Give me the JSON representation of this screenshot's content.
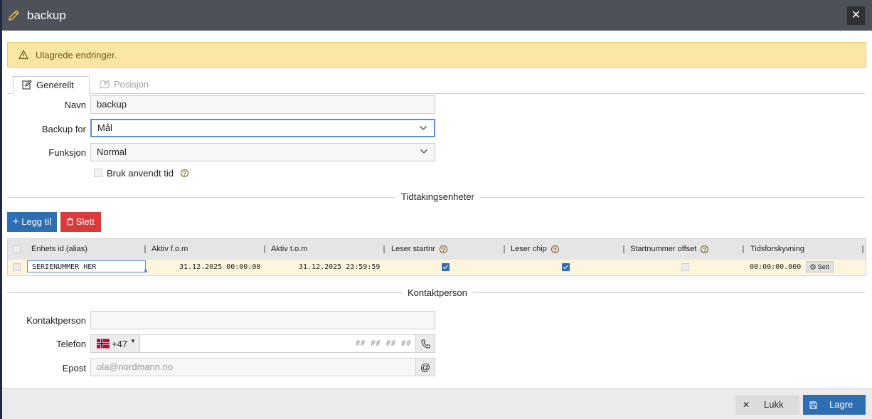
{
  "window": {
    "title": "backup",
    "close_glyph": "✕"
  },
  "warning": {
    "text": "Ulagrede endringer.",
    "icon": "warning-icon"
  },
  "tabs": [
    {
      "label": "Generellt",
      "icon": "edit-icon",
      "active": true
    },
    {
      "label": "Posisjon",
      "icon": "map-icon",
      "active": false
    }
  ],
  "form": {
    "name_label": "Navn",
    "name_value": "backup",
    "backup_for_label": "Backup for",
    "backup_for_value": "Mål",
    "function_label": "Funksjon",
    "function_value": "Normal",
    "use_applied_time_label": "Bruk anvendt tid"
  },
  "timing_section": {
    "title": "Tidtakingsenheter",
    "add_button": "Legg til",
    "delete_button": "Slett",
    "columns": [
      "Enhets id (alias)",
      "Aktiv f.o.m",
      "Aktiv t.o.m",
      "Leser startnr",
      "Leser chip",
      "Startnummer offset",
      "Tidsforskyvning"
    ],
    "rows": [
      {
        "id": "SERIENUMMER HER",
        "active_from": "31.12.2025 00:00:00",
        "active_to": "31.12.2025 23:59:59",
        "reads_startnr": true,
        "reads_chip": true,
        "startnr_offset": false,
        "time_shift": "00:00:00.000",
        "set_label": "Sett"
      }
    ]
  },
  "contact_section": {
    "title": "Kontaktperson",
    "contact_label": "Kontaktperson",
    "contact_value": "",
    "phone_label": "Telefon",
    "phone_prefix": "+47",
    "phone_placeholder": "## ## ## ##",
    "email_label": "Epost",
    "email_placeholder": "ola@nordmann.no"
  },
  "footer": {
    "close_label": "Lukk",
    "save_label": "Lagre"
  },
  "colors": {
    "accent": "#2d6fb2",
    "danger": "#d93a3a",
    "warning_bg": "#fbe6a3",
    "titlebar": "#4d5159"
  }
}
